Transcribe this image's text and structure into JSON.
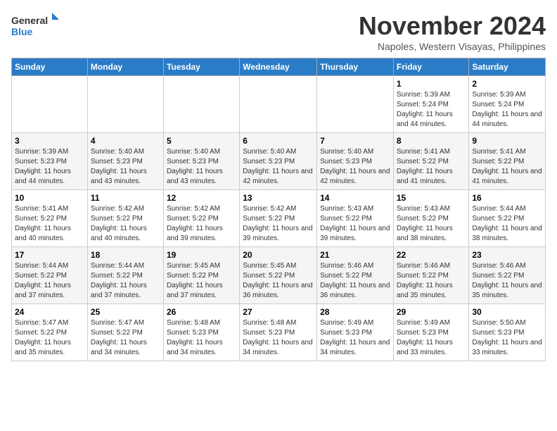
{
  "logo": {
    "line1": "General",
    "line2": "Blue"
  },
  "title": "November 2024",
  "location": "Napoles, Western Visayas, Philippines",
  "days_of_week": [
    "Sunday",
    "Monday",
    "Tuesday",
    "Wednesday",
    "Thursday",
    "Friday",
    "Saturday"
  ],
  "weeks": [
    [
      {
        "day": "",
        "info": ""
      },
      {
        "day": "",
        "info": ""
      },
      {
        "day": "",
        "info": ""
      },
      {
        "day": "",
        "info": ""
      },
      {
        "day": "",
        "info": ""
      },
      {
        "day": "1",
        "info": "Sunrise: 5:39 AM\nSunset: 5:24 PM\nDaylight: 11 hours and 44 minutes."
      },
      {
        "day": "2",
        "info": "Sunrise: 5:39 AM\nSunset: 5:24 PM\nDaylight: 11 hours and 44 minutes."
      }
    ],
    [
      {
        "day": "3",
        "info": "Sunrise: 5:39 AM\nSunset: 5:23 PM\nDaylight: 11 hours and 44 minutes."
      },
      {
        "day": "4",
        "info": "Sunrise: 5:40 AM\nSunset: 5:23 PM\nDaylight: 11 hours and 43 minutes."
      },
      {
        "day": "5",
        "info": "Sunrise: 5:40 AM\nSunset: 5:23 PM\nDaylight: 11 hours and 43 minutes."
      },
      {
        "day": "6",
        "info": "Sunrise: 5:40 AM\nSunset: 5:23 PM\nDaylight: 11 hours and 42 minutes."
      },
      {
        "day": "7",
        "info": "Sunrise: 5:40 AM\nSunset: 5:23 PM\nDaylight: 11 hours and 42 minutes."
      },
      {
        "day": "8",
        "info": "Sunrise: 5:41 AM\nSunset: 5:22 PM\nDaylight: 11 hours and 41 minutes."
      },
      {
        "day": "9",
        "info": "Sunrise: 5:41 AM\nSunset: 5:22 PM\nDaylight: 11 hours and 41 minutes."
      }
    ],
    [
      {
        "day": "10",
        "info": "Sunrise: 5:41 AM\nSunset: 5:22 PM\nDaylight: 11 hours and 40 minutes."
      },
      {
        "day": "11",
        "info": "Sunrise: 5:42 AM\nSunset: 5:22 PM\nDaylight: 11 hours and 40 minutes."
      },
      {
        "day": "12",
        "info": "Sunrise: 5:42 AM\nSunset: 5:22 PM\nDaylight: 11 hours and 39 minutes."
      },
      {
        "day": "13",
        "info": "Sunrise: 5:42 AM\nSunset: 5:22 PM\nDaylight: 11 hours and 39 minutes."
      },
      {
        "day": "14",
        "info": "Sunrise: 5:43 AM\nSunset: 5:22 PM\nDaylight: 11 hours and 39 minutes."
      },
      {
        "day": "15",
        "info": "Sunrise: 5:43 AM\nSunset: 5:22 PM\nDaylight: 11 hours and 38 minutes."
      },
      {
        "day": "16",
        "info": "Sunrise: 5:44 AM\nSunset: 5:22 PM\nDaylight: 11 hours and 38 minutes."
      }
    ],
    [
      {
        "day": "17",
        "info": "Sunrise: 5:44 AM\nSunset: 5:22 PM\nDaylight: 11 hours and 37 minutes."
      },
      {
        "day": "18",
        "info": "Sunrise: 5:44 AM\nSunset: 5:22 PM\nDaylight: 11 hours and 37 minutes."
      },
      {
        "day": "19",
        "info": "Sunrise: 5:45 AM\nSunset: 5:22 PM\nDaylight: 11 hours and 37 minutes."
      },
      {
        "day": "20",
        "info": "Sunrise: 5:45 AM\nSunset: 5:22 PM\nDaylight: 11 hours and 36 minutes."
      },
      {
        "day": "21",
        "info": "Sunrise: 5:46 AM\nSunset: 5:22 PM\nDaylight: 11 hours and 36 minutes."
      },
      {
        "day": "22",
        "info": "Sunrise: 5:46 AM\nSunset: 5:22 PM\nDaylight: 11 hours and 35 minutes."
      },
      {
        "day": "23",
        "info": "Sunrise: 5:46 AM\nSunset: 5:22 PM\nDaylight: 11 hours and 35 minutes."
      }
    ],
    [
      {
        "day": "24",
        "info": "Sunrise: 5:47 AM\nSunset: 5:22 PM\nDaylight: 11 hours and 35 minutes."
      },
      {
        "day": "25",
        "info": "Sunrise: 5:47 AM\nSunset: 5:22 PM\nDaylight: 11 hours and 34 minutes."
      },
      {
        "day": "26",
        "info": "Sunrise: 5:48 AM\nSunset: 5:23 PM\nDaylight: 11 hours and 34 minutes."
      },
      {
        "day": "27",
        "info": "Sunrise: 5:48 AM\nSunset: 5:23 PM\nDaylight: 11 hours and 34 minutes."
      },
      {
        "day": "28",
        "info": "Sunrise: 5:49 AM\nSunset: 5:23 PM\nDaylight: 11 hours and 34 minutes."
      },
      {
        "day": "29",
        "info": "Sunrise: 5:49 AM\nSunset: 5:23 PM\nDaylight: 11 hours and 33 minutes."
      },
      {
        "day": "30",
        "info": "Sunrise: 5:50 AM\nSunset: 5:23 PM\nDaylight: 11 hours and 33 minutes."
      }
    ]
  ]
}
